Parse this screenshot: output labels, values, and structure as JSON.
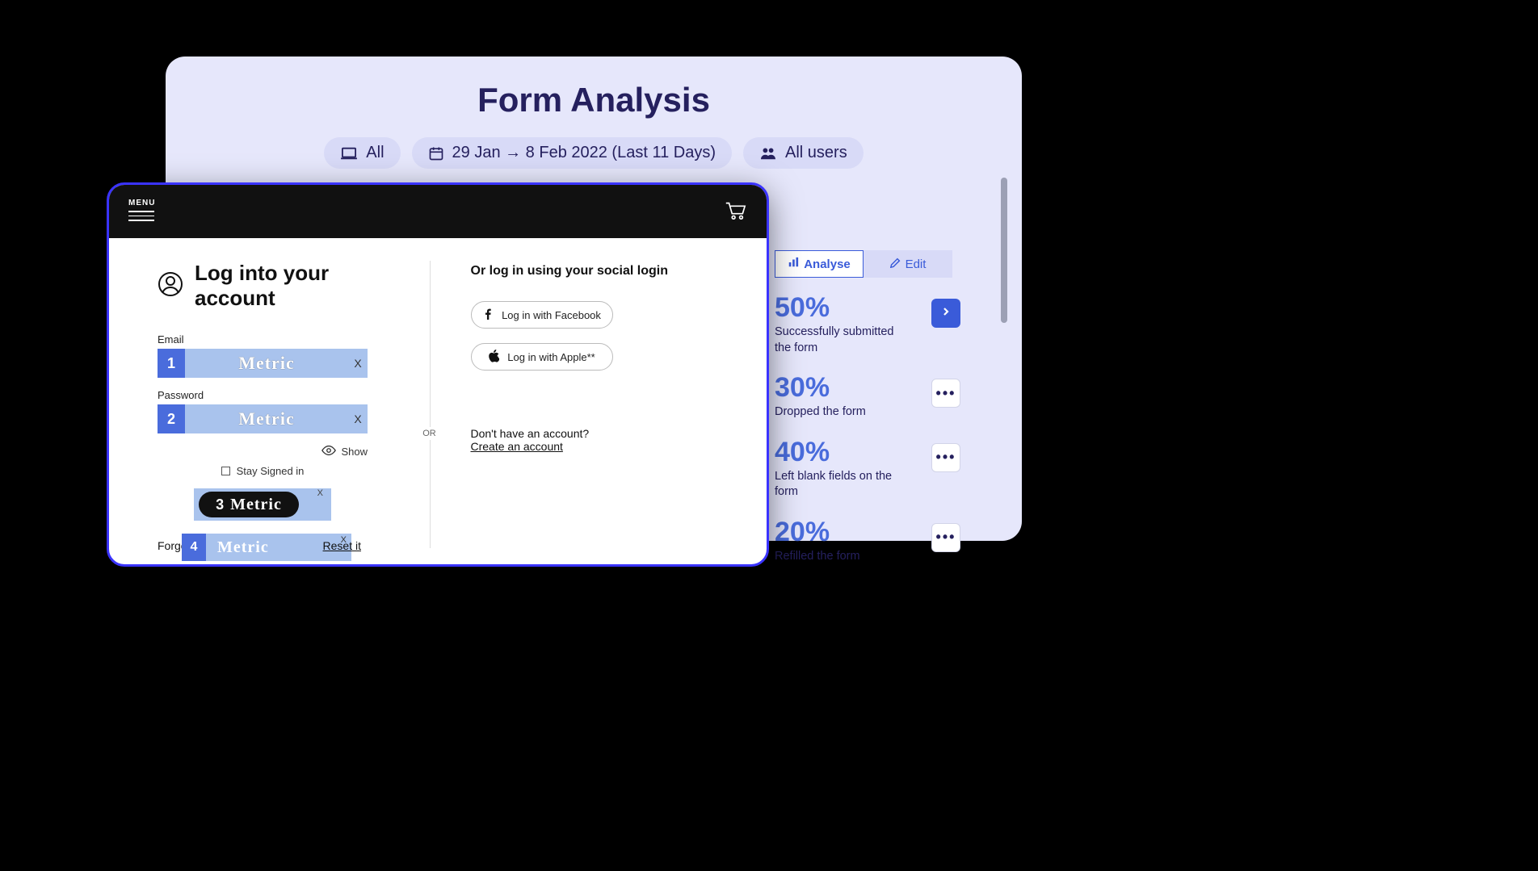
{
  "panel": {
    "title": "Form Analysis",
    "filters": {
      "device": "All",
      "daterange": "29 Jan → 8 Feb 2022 (Last 11 Days)",
      "audience": "All users"
    },
    "segments": {
      "analyse": "Analyse",
      "edit": "Edit"
    },
    "stats": [
      {
        "pct": "50%",
        "desc": "Successfully submitted the form",
        "action": "expand"
      },
      {
        "pct": "30%",
        "desc": "Dropped the form",
        "action": "menu"
      },
      {
        "pct": "40%",
        "desc": "Left blank fields on the form",
        "action": "menu"
      },
      {
        "pct": "20%",
        "desc": "Refilled the form",
        "action": "menu"
      }
    ]
  },
  "device": {
    "menu_label": "MENU",
    "login_title": "Log into your account",
    "fields": {
      "email_label": "Email",
      "password_label": "Password"
    },
    "show_label": "Show",
    "stay_label": "Stay Signed in",
    "or_label": "OR",
    "forgot_prefix": "Forgot your",
    "forgot_reset": "Reset it",
    "social_title": "Or log in using your social login",
    "social": {
      "facebook": "Log in with Facebook",
      "apple": "Log in with Apple**"
    },
    "no_account_q": "Don't have an account?",
    "create_account": "Create an account",
    "metric_word": "Metric",
    "overlays": {
      "m1": "1",
      "m2": "2",
      "m3": "3",
      "m4": "4",
      "close": "X"
    }
  }
}
